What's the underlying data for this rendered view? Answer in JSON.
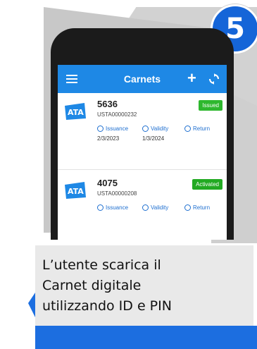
{
  "step": {
    "number": "5"
  },
  "app": {
    "title": "Carnets",
    "plus_label": "+"
  },
  "carnets": [
    {
      "number": "5636",
      "code": "USTA00000232",
      "status": "Issued",
      "actions": [
        "Issuance",
        "Validity",
        "Return"
      ],
      "issuance_date": "2/3/2023",
      "validity_date": "1/3/2024"
    },
    {
      "number": "4075",
      "code": "USTA00000208",
      "status": "Activated",
      "actions": [
        "Issuance",
        "Validity",
        "Return"
      ]
    }
  ],
  "logo_text": "ATA",
  "caption": {
    "line1": "L’utente scarica il",
    "line2": "Carnet digitale",
    "line3": "utilizzando ID e PIN"
  },
  "colors": {
    "accent": "#1e88e5",
    "badge": "#1565d8",
    "issued": "#2eb82e",
    "activated": "#22aa22"
  }
}
